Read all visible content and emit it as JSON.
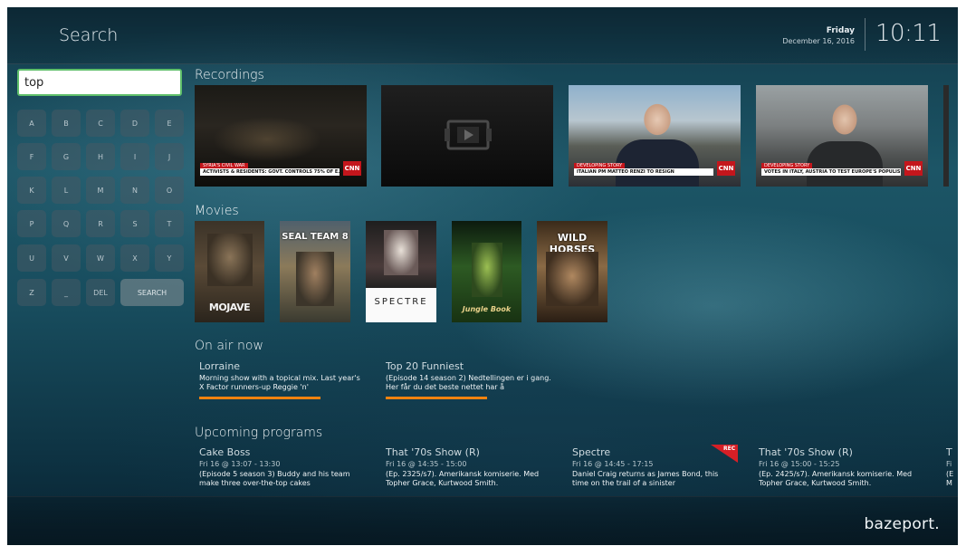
{
  "header": {
    "title": "Search",
    "day": "Friday",
    "date": "December 16, 2016",
    "time": "10:11"
  },
  "search": {
    "value": "top",
    "placeholder": ""
  },
  "keyboard": {
    "rows": [
      [
        "A",
        "B",
        "C",
        "D",
        "E"
      ],
      [
        "F",
        "G",
        "H",
        "I",
        "J"
      ],
      [
        "K",
        "L",
        "M",
        "N",
        "O"
      ],
      [
        "P",
        "Q",
        "R",
        "S",
        "T"
      ],
      [
        "U",
        "V",
        "W",
        "X",
        "Y"
      ],
      [
        "Z",
        "_",
        "DEL"
      ]
    ],
    "search_label": "SEARCH"
  },
  "recordings": {
    "title": "Recordings",
    "items": [
      {
        "tag": "SYRIA'S CIVIL WAR",
        "headline": "ACTIVISTS & RESIDENTS: GOVT. CONTROLS 75% OF E. ALEPPO",
        "network": "CNN"
      },
      {
        "placeholder_icon": "play-icon"
      },
      {
        "tag": "DEVELOPING STORY",
        "headline": "ITALIAN PM MATTEO RENZI TO RESIGN",
        "network": "CNN"
      },
      {
        "tag": "DEVELOPING STORY",
        "headline": "VOTES IN ITALY, AUSTRIA TO TEST EUROPE'S POPULISM RISE",
        "network": "CNN"
      }
    ]
  },
  "movies": {
    "title": "Movies",
    "posters": [
      {
        "text": "MOJAVE"
      },
      {
        "text": "SEAL TEAM 8"
      },
      {
        "text": "SPECTRE"
      },
      {
        "text": "Jungle Book"
      },
      {
        "text": "WILD HORSES"
      }
    ]
  },
  "on_air": {
    "title": "On air now",
    "items": [
      {
        "title": "Lorraine",
        "desc": "Morning show with a topical mix. Last year's X Factor runners-up Reggie 'n'",
        "progress": 1.0
      },
      {
        "title": "Top 20 Funniest",
        "desc": "(Episode 14 season 2) Nedtellingen er i gang. Her får du det beste nettet har å",
        "progress": 1.0
      }
    ]
  },
  "upcoming": {
    "title": "Upcoming programs",
    "items": [
      {
        "title": "Cake Boss",
        "time": "Fri 16 @ 13:07 - 13:30",
        "desc": "(Episode 5 season 3) Buddy and his team make three over-the-top cakes"
      },
      {
        "title": "That '70s Show (R)",
        "time": "Fri 16 @ 14:35 - 15:00",
        "desc": "(Ep. 2325/s7). Amerikansk komiserie. Med Topher Grace, Kurtwood Smith."
      },
      {
        "title": "Spectre",
        "time": "Fri 16 @ 14:45 - 17:15",
        "desc": "Daniel Craig returns as James Bond, this time on the trail of a sinister",
        "rec": "REC"
      },
      {
        "title": "That '70s Show (R)",
        "time": "Fri 16 @ 15:00 - 15:25",
        "desc": "(Ep. 2425/s7). Amerikansk komiserie. Med Topher Grace, Kurtwood Smith."
      },
      {
        "title": "T",
        "time": "Fi",
        "desc": "(E M"
      }
    ]
  },
  "footer": {
    "brand": "bazeport."
  },
  "colors": {
    "accent_progress": "#f0820f",
    "input_border": "#5fbf6a",
    "rec_badge": "#d61f26"
  }
}
